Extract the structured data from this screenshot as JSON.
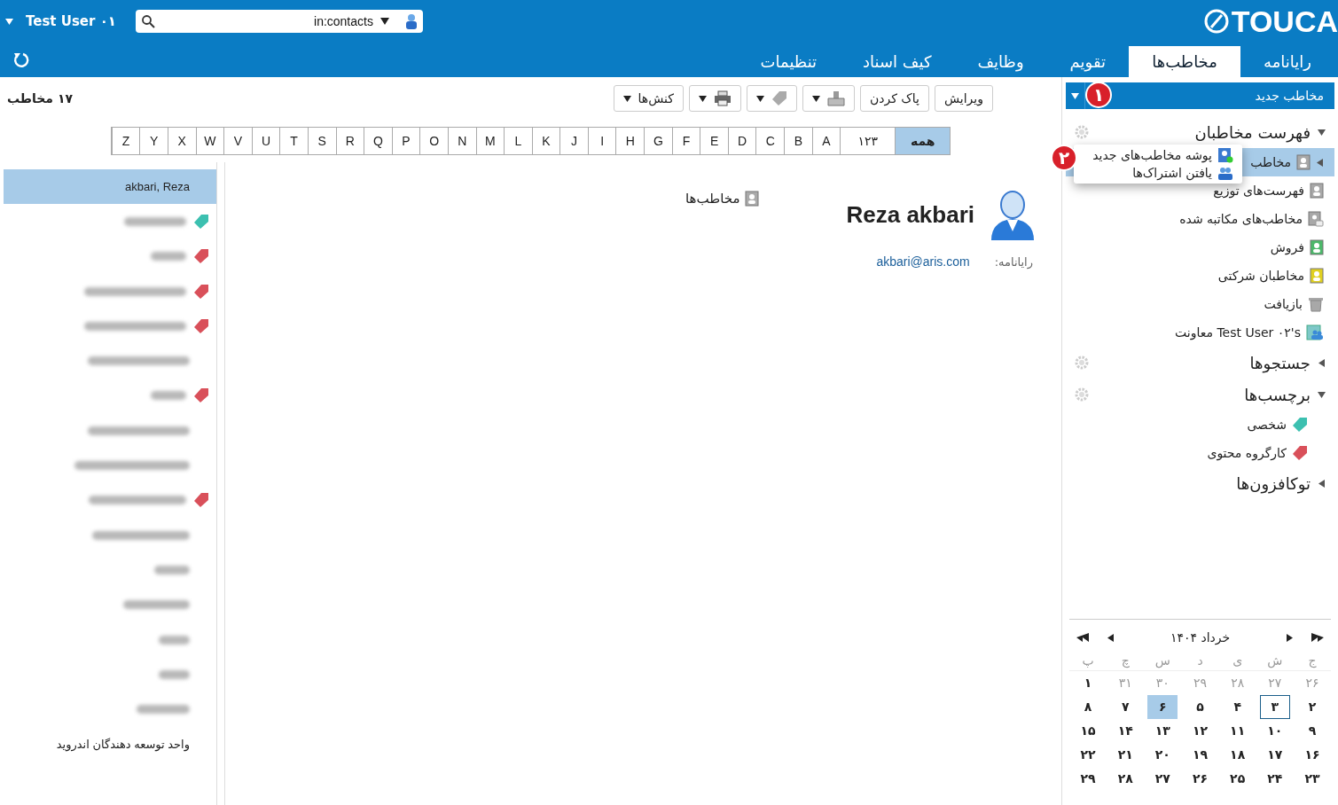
{
  "header": {
    "logo": "TOUCA",
    "user": "Test User ۰۱",
    "search": {
      "value": "in:contacts"
    }
  },
  "tabs": [
    {
      "label": "رایانامه",
      "selected": false
    },
    {
      "label": "مخاطب‌ها",
      "selected": true
    },
    {
      "label": "تقویم",
      "selected": false
    },
    {
      "label": "وظایف",
      "selected": false
    },
    {
      "label": "کیف اسناد",
      "selected": false
    },
    {
      "label": "تنظیمات",
      "selected": false
    }
  ],
  "new_button": {
    "label": "مخاطب جدید"
  },
  "badges": [
    "۱",
    "۲"
  ],
  "toolbar": [
    {
      "kind": "text",
      "label": "ویرایش"
    },
    {
      "kind": "text",
      "label": "پاک کردن"
    },
    {
      "kind": "move"
    },
    {
      "kind": "tag"
    },
    {
      "kind": "print"
    },
    {
      "kind": "menu",
      "label": "کنش‌ها"
    }
  ],
  "count": "۱۷ مخاطب",
  "alphabet": [
    {
      "label": "همه",
      "selected": true
    },
    {
      "label": "۱۲۳",
      "selected": false
    },
    {
      "label": "A",
      "selected": false
    },
    {
      "label": "B",
      "selected": false
    },
    {
      "label": "C",
      "selected": false
    },
    {
      "label": "D",
      "selected": false
    },
    {
      "label": "E",
      "selected": false
    },
    {
      "label": "F",
      "selected": false
    },
    {
      "label": "G",
      "selected": false
    },
    {
      "label": "H",
      "selected": false
    },
    {
      "label": "I",
      "selected": false
    },
    {
      "label": "J",
      "selected": false
    },
    {
      "label": "K",
      "selected": false
    },
    {
      "label": "L",
      "selected": false
    },
    {
      "label": "M",
      "selected": false
    },
    {
      "label": "N",
      "selected": false
    },
    {
      "label": "O",
      "selected": false
    },
    {
      "label": "P",
      "selected": false
    },
    {
      "label": "Q",
      "selected": false
    },
    {
      "label": "R",
      "selected": false
    },
    {
      "label": "S",
      "selected": false
    },
    {
      "label": "T",
      "selected": false
    },
    {
      "label": "U",
      "selected": false
    },
    {
      "label": "V",
      "selected": false
    },
    {
      "label": "W",
      "selected": false
    },
    {
      "label": "X",
      "selected": false
    },
    {
      "label": "Y",
      "selected": false
    },
    {
      "label": "Z",
      "selected": false
    }
  ],
  "sidebar": {
    "sections": [
      {
        "title": "فهرست مخاطبان",
        "expanded": true,
        "gear": true,
        "items": [
          {
            "label": "مخاطب",
            "kind": "book",
            "color": "#a8a8a8",
            "selected": true
          },
          {
            "label": "فهرست‌های توزیع",
            "kind": "book",
            "color": "#a8a8a8",
            "selected": false
          },
          {
            "label": "مخاطب‌های مکاتبه شده",
            "kind": "emailed",
            "color": "#a8a8a8",
            "selected": false
          },
          {
            "label": "فروش",
            "kind": "book",
            "color": "#4cb86a",
            "selected": false
          },
          {
            "label": "مخاطبان شرکتی",
            "kind": "book",
            "color": "#e0d020",
            "selected": false
          },
          {
            "label": "بازیافت",
            "kind": "trash",
            "color": "#a8a8a8",
            "selected": false
          },
          {
            "label": "Test User ۰۲'s معاونت",
            "kind": "shared",
            "color": "#3a8ad8",
            "selected": false
          }
        ]
      },
      {
        "title": "جستجوها",
        "expanded": false,
        "gear": true
      },
      {
        "title": "برچسب‌ها",
        "expanded": true,
        "gear": true,
        "items": [
          {
            "label": "شخصی",
            "kind": "tag",
            "color": "#3cc0b0",
            "selected": false
          },
          {
            "label": "کارگروه محتوی",
            "kind": "tag",
            "color": "#d9505a",
            "selected": false
          }
        ]
      },
      {
        "title": "توکافزون‌ها",
        "expanded": false,
        "gear": false
      }
    ]
  },
  "popup_menu": [
    {
      "label": "پوشه مخاطب‌های جدید",
      "kind": "folder"
    },
    {
      "label": "یافتن اشتراک‌ها",
      "kind": "share"
    }
  ],
  "calendar": {
    "title": "خرداد ۱۴۰۴",
    "weekdays": [
      "ج",
      "ش",
      "ی",
      "د",
      "س",
      "چ",
      "پ"
    ],
    "weeks": [
      [
        {
          "label": "۲۶",
          "outside": true,
          "selected": false,
          "today": false
        },
        {
          "label": "۲۷",
          "outside": true,
          "selected": false,
          "today": false
        },
        {
          "label": "۲۸",
          "outside": true,
          "selected": false,
          "today": false
        },
        {
          "label": "۲۹",
          "outside": true,
          "selected": false,
          "today": false
        },
        {
          "label": "۳۰",
          "outside": true,
          "selected": false,
          "today": false
        },
        {
          "label": "۳۱",
          "outside": true,
          "selected": false,
          "today": false
        },
        {
          "label": "۱",
          "outside": false,
          "selected": false,
          "today": false
        }
      ],
      [
        {
          "label": "۲",
          "outside": false,
          "selected": false,
          "today": false
        },
        {
          "label": "۳",
          "outside": false,
          "selected": false,
          "today": true
        },
        {
          "label": "۴",
          "outside": false,
          "selected": false,
          "today": false
        },
        {
          "label": "۵",
          "outside": false,
          "selected": false,
          "today": false
        },
        {
          "label": "۶",
          "outside": false,
          "selected": true,
          "today": false
        },
        {
          "label": "۷",
          "outside": false,
          "selected": false,
          "today": false
        },
        {
          "label": "۸",
          "outside": false,
          "selected": false,
          "today": false
        }
      ],
      [
        {
          "label": "۹",
          "outside": false,
          "selected": false,
          "today": false
        },
        {
          "label": "۱۰",
          "outside": false,
          "selected": false,
          "today": false
        },
        {
          "label": "۱۱",
          "outside": false,
          "selected": false,
          "today": false
        },
        {
          "label": "۱۲",
          "outside": false,
          "selected": false,
          "today": false
        },
        {
          "label": "۱۳",
          "outside": false,
          "selected": false,
          "today": false
        },
        {
          "label": "۱۴",
          "outside": false,
          "selected": false,
          "today": false
        },
        {
          "label": "۱۵",
          "outside": false,
          "selected": false,
          "today": false
        }
      ],
      [
        {
          "label": "۱۶",
          "outside": false,
          "selected": false,
          "today": false
        },
        {
          "label": "۱۷",
          "outside": false,
          "selected": false,
          "today": false
        },
        {
          "label": "۱۸",
          "outside": false,
          "selected": false,
          "today": false
        },
        {
          "label": "۱۹",
          "outside": false,
          "selected": false,
          "today": false
        },
        {
          "label": "۲۰",
          "outside": false,
          "selected": false,
          "today": false
        },
        {
          "label": "۲۱",
          "outside": false,
          "selected": false,
          "today": false
        },
        {
          "label": "۲۲",
          "outside": false,
          "selected": false,
          "today": false
        }
      ],
      [
        {
          "label": "۲۳",
          "outside": false,
          "selected": false,
          "today": false
        },
        {
          "label": "۲۴",
          "outside": false,
          "selected": false,
          "today": false
        },
        {
          "label": "۲۵",
          "outside": false,
          "selected": false,
          "today": false
        },
        {
          "label": "۲۶",
          "outside": false,
          "selected": false,
          "today": false
        },
        {
          "label": "۲۷",
          "outside": false,
          "selected": false,
          "today": false
        },
        {
          "label": "۲۸",
          "outside": false,
          "selected": false,
          "today": false
        },
        {
          "label": "۲۹",
          "outside": false,
          "selected": false,
          "today": false
        }
      ]
    ]
  },
  "contact": {
    "name": "Reza akbari",
    "folder": "مخاطب‌ها",
    "fields": [
      {
        "label": "رایانامه:",
        "value": "akbari@aris.com"
      }
    ]
  },
  "contacts": [
    {
      "name": "akbari, Reza",
      "blurred": false,
      "selected": true
    },
    {
      "blurred": true,
      "selected": false,
      "color": "#3cc0b0"
    },
    {
      "blurred": true,
      "selected": false,
      "color": "#d9505a"
    },
    {
      "blurred": true,
      "selected": false,
      "color": "#d9505a"
    },
    {
      "blurred": true,
      "selected": false,
      "color": "#d9505a"
    },
    {
      "blurred": true,
      "selected": false
    },
    {
      "blurred": true,
      "selected": false,
      "color": "#d9505a"
    },
    {
      "blurred": true,
      "selected": false
    },
    {
      "blurred": true,
      "selected": false
    },
    {
      "blurred": true,
      "selected": false,
      "color": "#d9505a"
    },
    {
      "blurred": true,
      "selected": false
    },
    {
      "blurred": true,
      "selected": false
    },
    {
      "blurred": true,
      "selected": false
    },
    {
      "blurred": true,
      "selected": false
    },
    {
      "blurred": true,
      "selected": false
    },
    {
      "blurred": true,
      "selected": false
    },
    {
      "name": "واحد توسعه دهندگان اندروید",
      "blurred": false,
      "selected": false
    }
  ]
}
